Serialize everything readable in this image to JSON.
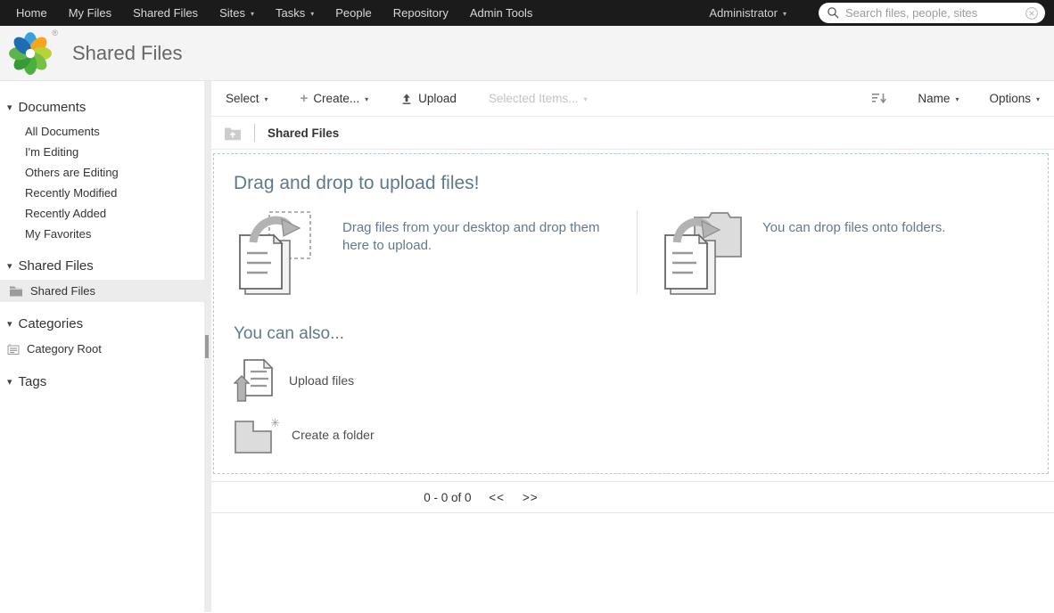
{
  "icons": {
    "caret": "▾",
    "plus": "+",
    "sparkle": "✳",
    "registered": "®"
  },
  "topnav": {
    "items": [
      {
        "label": "Home",
        "caret": false
      },
      {
        "label": "My Files",
        "caret": false
      },
      {
        "label": "Shared Files",
        "caret": false
      },
      {
        "label": "Sites",
        "caret": true
      },
      {
        "label": "Tasks",
        "caret": true
      },
      {
        "label": "People",
        "caret": false
      },
      {
        "label": "Repository",
        "caret": false
      },
      {
        "label": "Admin Tools",
        "caret": false
      }
    ],
    "user": {
      "label": "Administrator"
    },
    "search": {
      "placeholder": "Search files, people, sites",
      "value": ""
    }
  },
  "header": {
    "title": "Shared Files"
  },
  "sidebar": {
    "sections": [
      {
        "header": "Documents",
        "items": [
          "All Documents",
          "I'm Editing",
          "Others are Editing",
          "Recently Modified",
          "Recently Added",
          "My Favorites"
        ]
      },
      {
        "header": "Shared Files",
        "selected_item": "Shared Files"
      },
      {
        "header": "Categories",
        "item": "Category Root"
      },
      {
        "header": "Tags"
      }
    ]
  },
  "toolbar": {
    "select": "Select",
    "create": "Create...",
    "upload": "Upload",
    "selected_items": "Selected Items...",
    "sort_by": "Name",
    "options": "Options"
  },
  "breadcrumb": {
    "current": "Shared Files"
  },
  "dropzone": {
    "title": "Drag and drop to upload files!",
    "desktop_hint": "Drag files from your desktop and drop them here to upload.",
    "folders_hint": "You can drop files onto folders.",
    "also_title": "You can also...",
    "upload_link": "Upload files",
    "create_folder_link": "Create a folder"
  },
  "pagination": {
    "range": "0 - 0 of 0",
    "prev": "<<",
    "next": ">>"
  },
  "colors": {
    "nav_bg": "#1b1b1b",
    "header_bg": "#f4f4f4",
    "accent_heading": "#5f7a8a",
    "dropzone_border": "#a9cbdf",
    "selected_item_bg": "#ececec"
  }
}
